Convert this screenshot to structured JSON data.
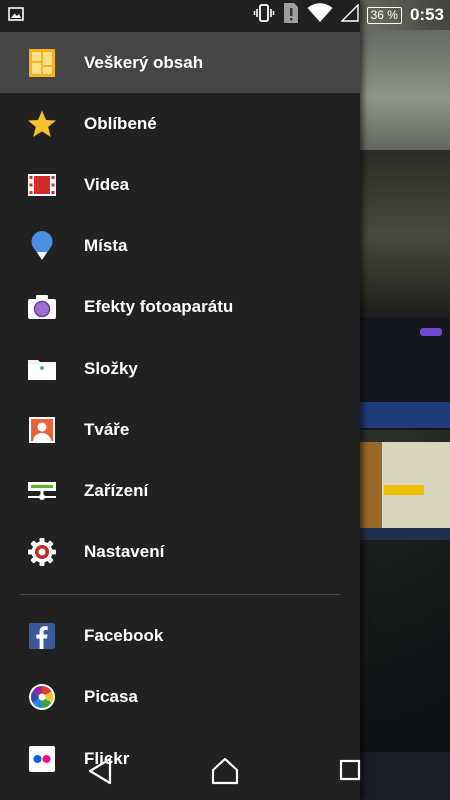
{
  "status_bar": {
    "battery": "36 %",
    "time": "0:53"
  },
  "drawer": {
    "items": [
      {
        "label": "Veškerý obsah",
        "icon": "all-content-icon"
      },
      {
        "label": "Oblíbené",
        "icon": "star-icon"
      },
      {
        "label": "Videa",
        "icon": "film-icon"
      },
      {
        "label": "Místa",
        "icon": "map-pin-icon"
      },
      {
        "label": "Efekty fotoaparátu",
        "icon": "camera-icon"
      },
      {
        "label": "Složky",
        "icon": "folder-icon"
      },
      {
        "label": "Tváře",
        "icon": "face-icon"
      },
      {
        "label": "Zařízení",
        "icon": "device-icon"
      },
      {
        "label": "Nastavení",
        "icon": "gear-icon"
      }
    ],
    "accounts": [
      {
        "label": "Facebook",
        "icon": "facebook-icon"
      },
      {
        "label": "Picasa",
        "icon": "picasa-icon"
      },
      {
        "label": "Flickr",
        "icon": "flickr-icon"
      }
    ]
  },
  "colors": {
    "drawer_bg": "#212121",
    "active_bg": "#454545",
    "star": "#f6c12c",
    "pin": "#4a90e2",
    "facebook": "#3b5998",
    "flickr_pink": "#ff0084",
    "flickr_blue": "#0063dc"
  }
}
